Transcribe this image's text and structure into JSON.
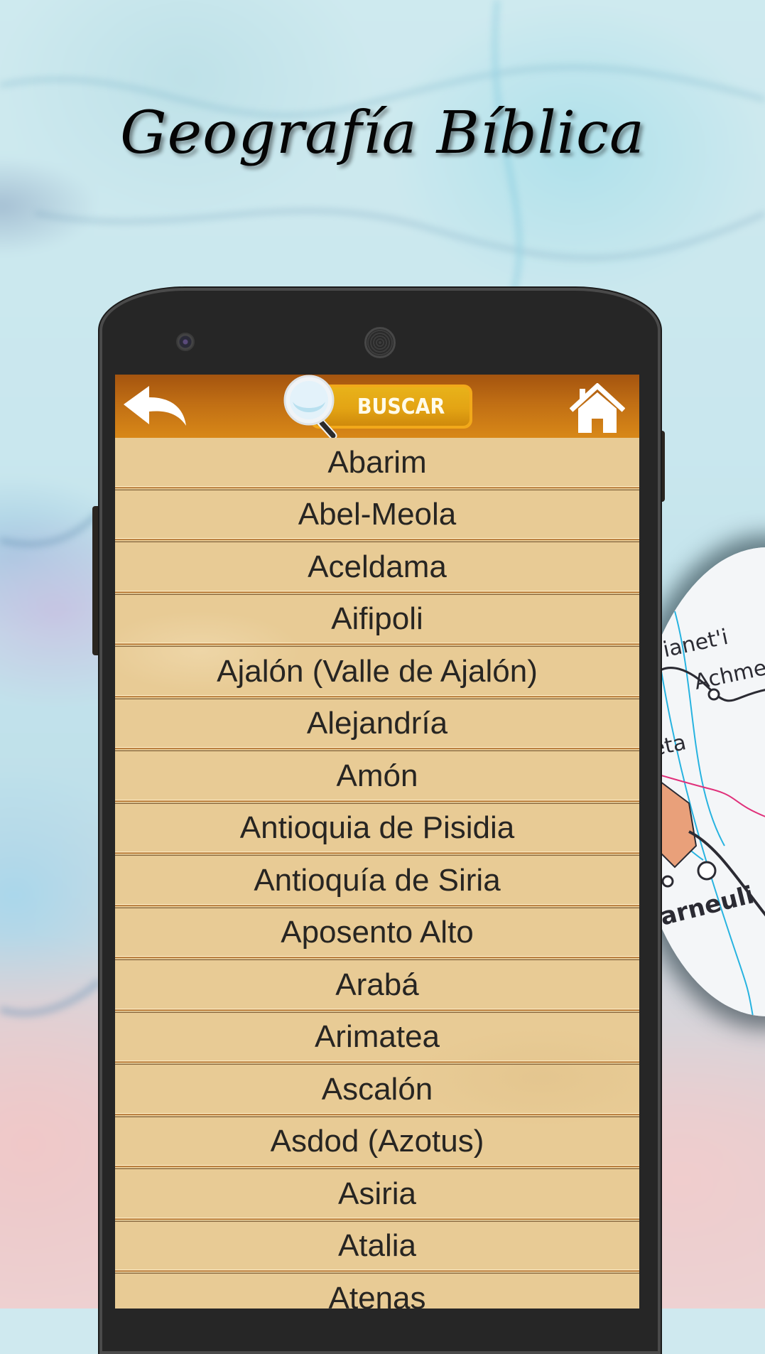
{
  "app": {
    "title": "Geografía Bíblica"
  },
  "toolbar": {
    "back_icon": "back-arrow-icon",
    "search_icon": "magnifier-icon",
    "search_label": "BUSCAR",
    "home_icon": "home-icon"
  },
  "colors": {
    "toolbar_top": "#a4540f",
    "toolbar_bottom": "#d88818",
    "search_button": "#e3a414",
    "list_background": "#e8cb95",
    "list_text": "#272522",
    "divider": "#a8621c"
  },
  "places": [
    {
      "name": "Abarim"
    },
    {
      "name": "Abel-Meola"
    },
    {
      "name": "Aceldama"
    },
    {
      "name": "Aifipoli"
    },
    {
      "name": "Ajalón (Valle de Ajalón)"
    },
    {
      "name": "Alejandría"
    },
    {
      "name": "Amón"
    },
    {
      "name": "Antioquia de Pisidia"
    },
    {
      "name": "Antioquía de Siria"
    },
    {
      "name": "Aposento Alto"
    },
    {
      "name": "Arabá"
    },
    {
      "name": "Arimatea"
    },
    {
      "name": "Ascalón"
    },
    {
      "name": "Asdod (Azotus)"
    },
    {
      "name": "Asiria"
    },
    {
      "name": "Atalia"
    },
    {
      "name": "Atenas"
    }
  ],
  "background_map_labels": [
    "T'ianet'i",
    "Achme",
    "cheta",
    "Marneuli"
  ]
}
